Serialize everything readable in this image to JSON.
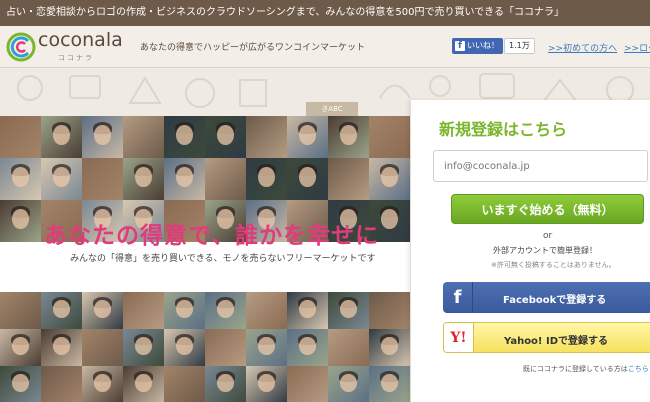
{
  "topbar": {
    "text": "占い・恋愛相談からロゴの作成・ビジネスのクラウドソーシングまで、みんなの得意を500円で売り買いできる「ココナラ」"
  },
  "header": {
    "logo_text": "coconala",
    "logo_sub": "ココナラ",
    "tagline": "あなたの得意でハッピーが広がるワンコインマーケット",
    "fb_like_label": "いいね！",
    "fb_like_count": "1.1万",
    "first_time_link": ">>初めての方へ",
    "login_link": ">>ログ"
  },
  "hero": {
    "sign_text": "きABC",
    "headline": "あなたの得意で、誰かを幸せに",
    "subline": "みんなの「得意」を売り買いできる、モノを売らないフリーマーケットです"
  },
  "signup": {
    "title": "新規登録はこちら",
    "email_placeholder": "info@coconala.jp",
    "start_button": "いますぐ始める（無料）",
    "or_text": "or",
    "external_text": "外部アカウントで簡単登録！",
    "note_text": "※許可無く投稿することはありません。",
    "facebook_button": "Facebookで登録する",
    "yahoo_button": "Yahoo! IDで登録する",
    "already_text": "既にココナラに登録している方は",
    "already_link": "こちら"
  },
  "colors": {
    "brand_green": "#7bb52b",
    "headline_pink": "#e23b7b",
    "topbar_brown": "#6e5a48",
    "facebook_blue": "#3b5998",
    "yahoo_yellow": "#f7e15e",
    "link_blue": "#3b7bbf"
  },
  "icons": {
    "logo": "coconala-c-logo-icon",
    "facebook": "facebook-f-icon",
    "yahoo": "yahoo-y-icon"
  }
}
